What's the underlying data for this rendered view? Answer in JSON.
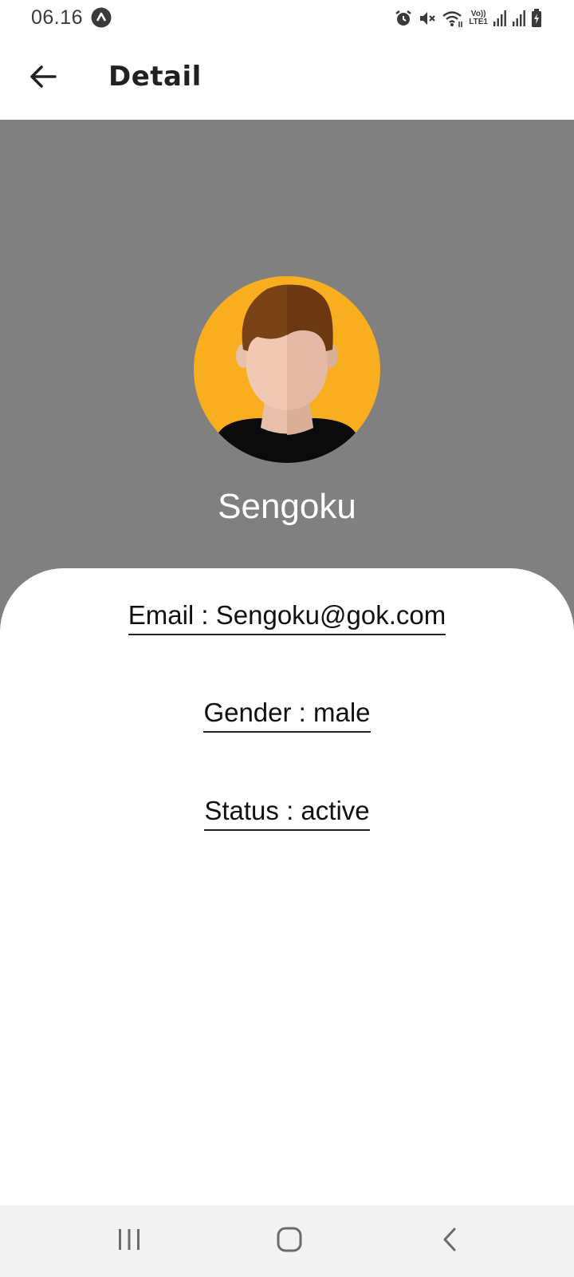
{
  "status_bar": {
    "time": "06.16",
    "icons": [
      "app-notification-icon",
      "alarm-icon",
      "mute-icon",
      "wifi-icon",
      "volte-icon",
      "signal-icon",
      "signal-icon",
      "battery-charging-icon"
    ],
    "volte_label_top": "Vo))",
    "volte_label_bottom": "LTE1"
  },
  "app_bar": {
    "title": "Detail",
    "back_icon": "arrow-left-icon"
  },
  "profile": {
    "name": "Sengoku",
    "avatar_icon": "male-avatar-icon",
    "header_color": "#808080",
    "avatar_bg_color": "#F8AE1E"
  },
  "details": {
    "email": "Email : Sengoku@gok.com",
    "gender": "Gender : male",
    "status": "Status : active"
  },
  "nav_bar": {
    "recents_icon": "recents-icon",
    "home_icon": "home-icon",
    "back_icon": "back-chevron-icon"
  }
}
